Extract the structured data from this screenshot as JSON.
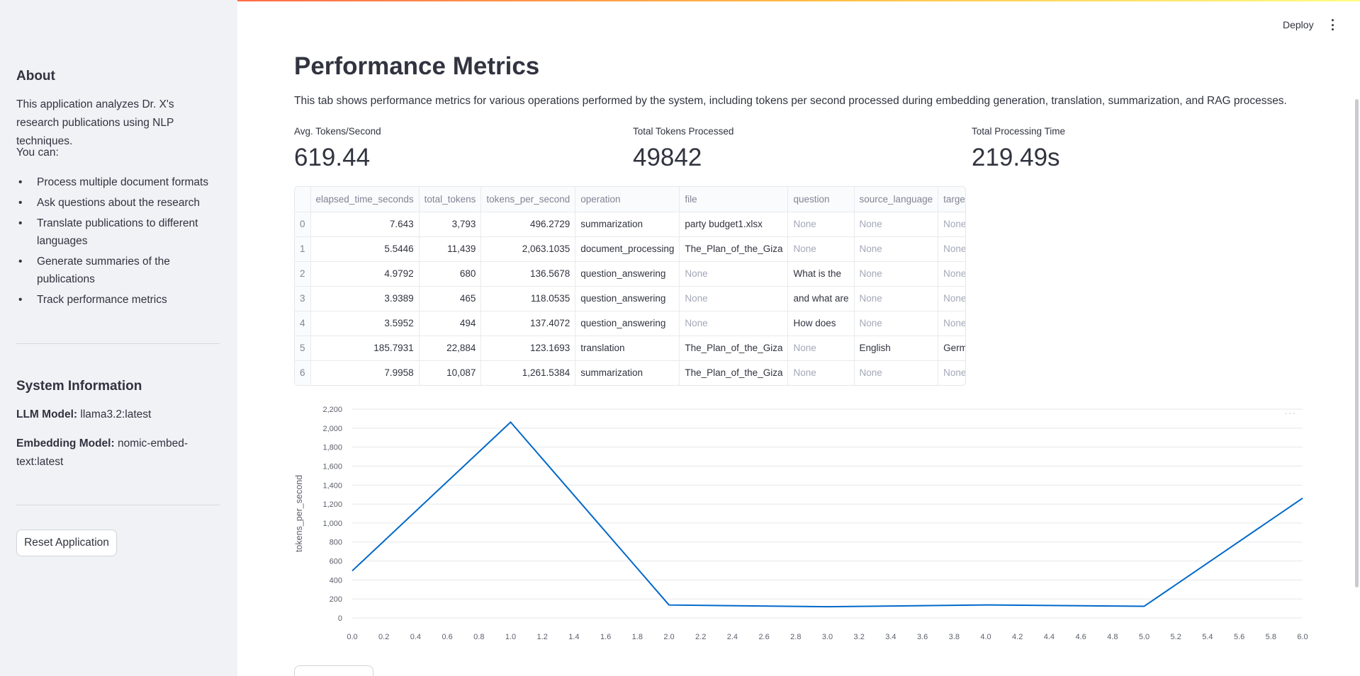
{
  "header": {
    "deploy_label": "Deploy"
  },
  "sidebar": {
    "about_title": "About",
    "about_text": "This application analyzes Dr. X's research publications using NLP techniques.",
    "you_can": "You can:",
    "items": [
      "Process multiple document formats",
      "Ask questions about the research",
      "Translate publications to different languages",
      "Generate summaries of the publications",
      "Track performance metrics"
    ],
    "system_title": "System Information",
    "llm_label": "LLM Model:",
    "llm_value": "llama3.2:latest",
    "embed_label": "Embedding Model:",
    "embed_value": "nomic-embed-text:latest",
    "reset_button": "Reset Application"
  },
  "main": {
    "title": "Performance Metrics",
    "description": "This tab shows performance metrics for various operations performed by the system, including tokens per second processed during embedding generation, translation, summarization, and RAG processes.",
    "metrics": [
      {
        "label": "Avg. Tokens/Second",
        "value": "619.44"
      },
      {
        "label": "Total Tokens Processed",
        "value": "49842"
      },
      {
        "label": "Total Processing Time",
        "value": "219.49s"
      }
    ]
  },
  "table": {
    "columns": [
      "",
      "elapsed_time_seconds",
      "total_tokens",
      "tokens_per_second",
      "operation",
      "file",
      "question",
      "source_language",
      "target_language"
    ],
    "rows": [
      [
        "0",
        "7.643",
        "3,793",
        "496.2729",
        "summarization",
        "party budget1.xlsx",
        "None",
        "None",
        "None"
      ],
      [
        "1",
        "5.5446",
        "11,439",
        "2,063.1035",
        "document_processing",
        "The_Plan_of_the_Giza",
        "None",
        "None",
        "None"
      ],
      [
        "2",
        "4.9792",
        "680",
        "136.5678",
        "question_answering",
        "None",
        "What is the",
        "None",
        "None"
      ],
      [
        "3",
        "3.9389",
        "465",
        "118.0535",
        "question_answering",
        "None",
        "and what are",
        "None",
        "None"
      ],
      [
        "4",
        "3.5952",
        "494",
        "137.4072",
        "question_answering",
        "None",
        "How does",
        "None",
        "None"
      ],
      [
        "5",
        "185.7931",
        "22,884",
        "123.1693",
        "translation",
        "The_Plan_of_the_Giza",
        "None",
        "English",
        "German"
      ],
      [
        "6",
        "7.9958",
        "10,087",
        "1,261.5384",
        "summarization",
        "The_Plan_of_the_Giza",
        "None",
        "None",
        "None"
      ]
    ]
  },
  "chart_data": {
    "type": "line",
    "x": [
      0,
      1,
      2,
      3,
      4,
      5,
      6
    ],
    "series": [
      {
        "values": [
          496.2729,
          2063.1035,
          136.5678,
          118.0535,
          137.4072,
          123.1693,
          1261.5384
        ]
      }
    ],
    "xlabel": "",
    "ylabel": "tokens_per_second",
    "xlim": [
      0,
      6
    ],
    "ylim": [
      0,
      2200
    ],
    "x_ticks": [
      "0.0",
      "0.2",
      "0.4",
      "0.6",
      "0.8",
      "1.0",
      "1.2",
      "1.4",
      "1.6",
      "1.8",
      "2.0",
      "2.2",
      "2.4",
      "2.6",
      "2.8",
      "3.0",
      "3.2",
      "3.4",
      "3.6",
      "3.8",
      "4.0",
      "4.2",
      "4.4",
      "4.6",
      "4.8",
      "5.0",
      "5.2",
      "5.4",
      "5.6",
      "5.8",
      "6.0"
    ],
    "y_ticks": [
      "0",
      "200",
      "400",
      "600",
      "800",
      "1,000",
      "1,200",
      "1,400",
      "1,600",
      "1,800",
      "2,000",
      "2,200"
    ],
    "grid": true,
    "line_color": "#0068c9"
  }
}
